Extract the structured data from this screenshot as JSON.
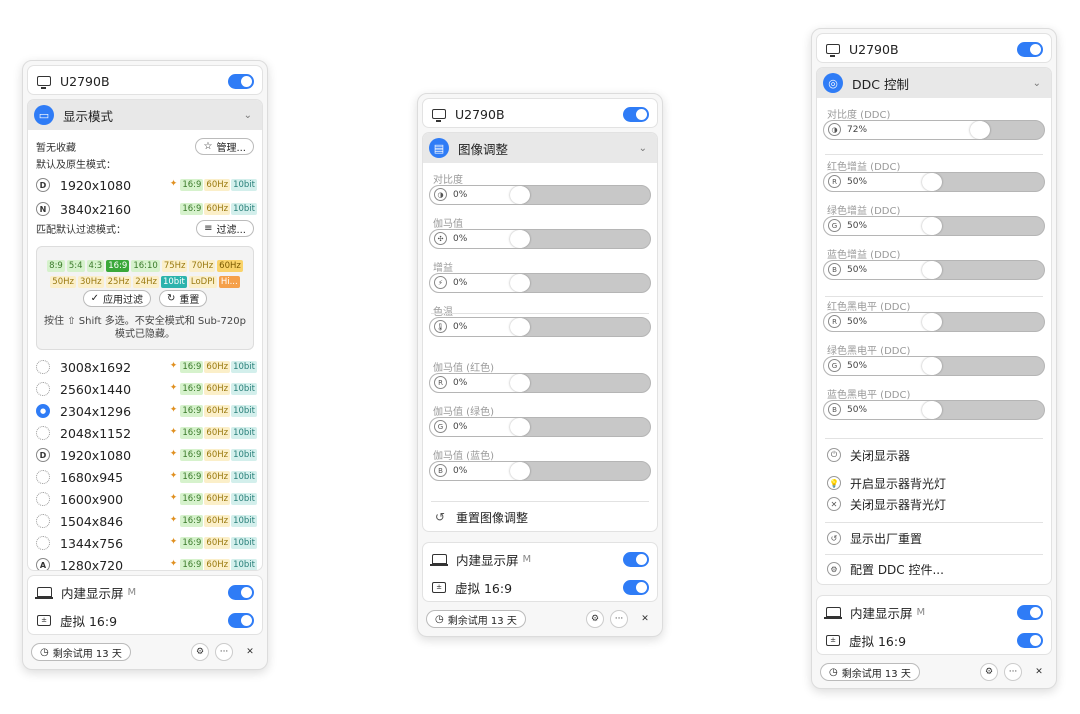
{
  "monitor": {
    "name": "U2790B"
  },
  "builtin": {
    "name": "内建显示屏",
    "badge": "M"
  },
  "virtual": {
    "name": "虚拟 16:9",
    "icon_text": "±"
  },
  "footer": {
    "trial": "剩余试用 13 天"
  },
  "panel1": {
    "section_title": "显示模式",
    "no_favorites": "暂无收藏",
    "manage_label": "管理...",
    "default_modes_label": "默认及原生模式：",
    "native": [
      {
        "badge": "D",
        "res": "1920x1080",
        "sparkle": true,
        "tags": [
          "16:9",
          "60Hz",
          "10bit"
        ]
      },
      {
        "badge": "N",
        "res": "3840x2160",
        "sparkle": false,
        "tags": [
          "16:9",
          "60Hz",
          "10bit"
        ]
      }
    ],
    "filter_label": "匹配默认过滤模式：",
    "filter_button": "过滤...",
    "filter_chips_row1": [
      "8:9",
      "5:4",
      "4:3",
      "16:9",
      "16:10",
      "75Hz",
      "70Hz",
      "60Hz"
    ],
    "filter_chips_row2": [
      "50Hz",
      "30Hz",
      "25Hz",
      "24Hz",
      "10bit",
      "LoDPI",
      "Hi..."
    ],
    "apply_filter": "应用过滤",
    "reset": "重置",
    "hint": "按住 ⇧ Shift 多选。不安全模式和 Sub-720p 模式已隐藏。",
    "modes": [
      {
        "res": "3008x1692",
        "state": "dash"
      },
      {
        "res": "2560x1440",
        "state": "dash"
      },
      {
        "res": "2304x1296",
        "state": "on"
      },
      {
        "res": "2048x1152",
        "state": "dash"
      },
      {
        "res": "1920x1080",
        "state": "D"
      },
      {
        "res": "1680x945",
        "state": "dash"
      },
      {
        "res": "1600x900",
        "state": "dash"
      },
      {
        "res": "1504x846",
        "state": "dash"
      },
      {
        "res": "1344x756",
        "state": "dash"
      },
      {
        "res": "1280x720",
        "state": "A"
      }
    ],
    "mode_tags": [
      "16:9",
      "60Hz",
      "10bit"
    ]
  },
  "panel2": {
    "section_title": "图像调整",
    "sliders": [
      {
        "label": "对比度",
        "icon": "◑",
        "value": "0%"
      },
      {
        "label": "伽马值",
        "icon": "✣",
        "value": "0%"
      },
      {
        "label": "增益",
        "icon": "⚡",
        "value": "0%"
      },
      {
        "label": "色温",
        "icon": "🌡",
        "value": "0%"
      },
      {
        "label": "伽马值 (红色)",
        "icon": "R",
        "value": "0%"
      },
      {
        "label": "伽马值 (绿色)",
        "icon": "G",
        "value": "0%"
      },
      {
        "label": "伽马值 (蓝色)",
        "icon": "B",
        "value": "0%"
      }
    ],
    "reset_label": "重置图像调整"
  },
  "panel3": {
    "section_title": "DDC 控制",
    "sliders": [
      {
        "label": "对比度 (DDC)",
        "icon": "◑",
        "value": "72%",
        "level": 0.72
      },
      {
        "label": "红色增益 (DDC)",
        "icon": "R",
        "value": "50%",
        "level": 0.5
      },
      {
        "label": "绿色增益 (DDC)",
        "icon": "G",
        "value": "50%",
        "level": 0.5
      },
      {
        "label": "蓝色增益 (DDC)",
        "icon": "B",
        "value": "50%",
        "level": 0.5
      },
      {
        "label": "红色黑电平 (DDC)",
        "icon": "R",
        "value": "50%",
        "level": 0.5
      },
      {
        "label": "绿色黑电平 (DDC)",
        "icon": "G",
        "value": "50%",
        "level": 0.5
      },
      {
        "label": "蓝色黑电平 (DDC)",
        "icon": "B",
        "value": "50%",
        "level": 0.5
      }
    ],
    "menu": [
      {
        "label": "关闭显示器",
        "icon": "⏻"
      },
      {
        "label": "开启显示器背光灯",
        "icon": "💡"
      },
      {
        "label": "关闭显示器背光灯",
        "icon": "✕"
      },
      {
        "label": "显示出厂重置",
        "icon": "↺"
      },
      {
        "label": "配置 DDC 控件...",
        "icon": "⚙"
      }
    ]
  }
}
